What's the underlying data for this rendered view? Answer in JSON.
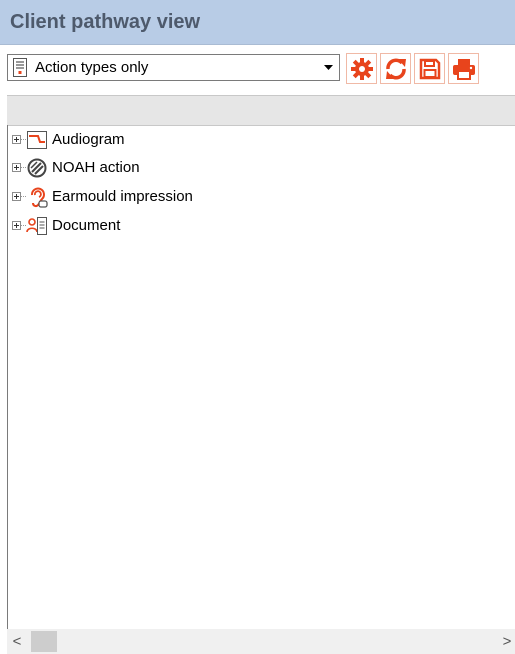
{
  "title": "Client pathway view",
  "toolbar": {
    "filter_selected": "Action types only",
    "buttons": [
      {
        "name": "settings",
        "icon": "gear-icon"
      },
      {
        "name": "refresh",
        "icon": "refresh-icon"
      },
      {
        "name": "save",
        "icon": "save-icon"
      },
      {
        "name": "print",
        "icon": "print-icon"
      }
    ]
  },
  "tree": {
    "items": [
      {
        "label": "Audiogram",
        "icon": "audiogram-icon"
      },
      {
        "label": "NOAH action",
        "icon": "noah-icon"
      },
      {
        "label": "Earmould impression",
        "icon": "ear-icon"
      },
      {
        "label": "Document",
        "icon": "document-person-icon"
      }
    ]
  },
  "scrollbar": {
    "left_arrow": "<",
    "right_arrow": ">"
  },
  "colors": {
    "title_bg": "#b8cce6",
    "accent": "#e8441c",
    "strip": "#e6e6e6"
  }
}
